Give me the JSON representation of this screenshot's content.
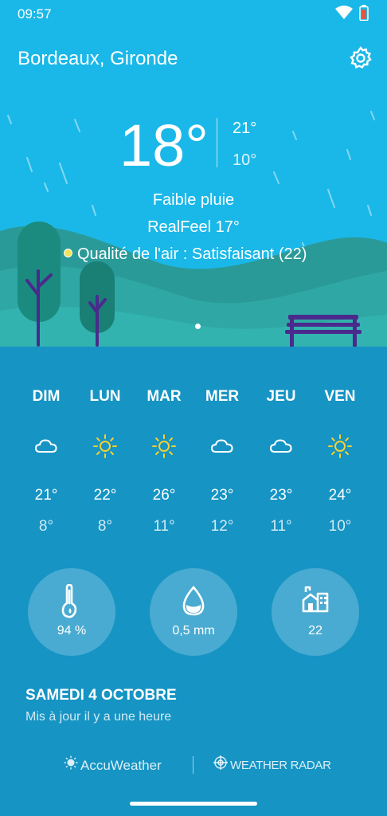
{
  "status": {
    "time": "09:57",
    "wifi_icon": "wifi-icon",
    "battery_icon": "battery-icon"
  },
  "header": {
    "city": "Bordeaux, Gironde",
    "settings_icon": "gear-icon"
  },
  "current": {
    "temp": "18°",
    "high": "21°",
    "low": "10°",
    "condition": "Faible pluie",
    "realfeel": "RealFeel 17°",
    "air_quality": "Qualité de l'air : Satisfaisant (22)",
    "air_quality_color": "#f3e35a"
  },
  "forecast": [
    {
      "day": "DIM",
      "icon": "cloud-icon",
      "high": "21°",
      "low": "8°"
    },
    {
      "day": "LUN",
      "icon": "sun-icon",
      "high": "22°",
      "low": "8°"
    },
    {
      "day": "MAR",
      "icon": "sun-icon",
      "high": "26°",
      "low": "11°"
    },
    {
      "day": "MER",
      "icon": "cloud-icon",
      "high": "23°",
      "low": "12°"
    },
    {
      "day": "JEU",
      "icon": "cloud-icon",
      "high": "23°",
      "low": "11°"
    },
    {
      "day": "VEN",
      "icon": "sun-icon",
      "high": "24°",
      "low": "10°"
    }
  ],
  "details": {
    "humidity": {
      "icon": "thermometer-drop-icon",
      "value": "94 %"
    },
    "precipitation": {
      "icon": "water-drop-icon",
      "value": "0,5 mm"
    },
    "air_quality": {
      "icon": "air-quality-building-icon",
      "value": "22"
    }
  },
  "date": "SAMEDI 4 OCTOBRE",
  "updated": "Mis à jour il y a une heure",
  "brands": {
    "accuweather": "AccuWeather",
    "weather_radar": "WEATHER RADAR"
  },
  "colors": {
    "sky": "#1ab8e8",
    "lower": "#1694c4",
    "sun": "#f5d130"
  }
}
